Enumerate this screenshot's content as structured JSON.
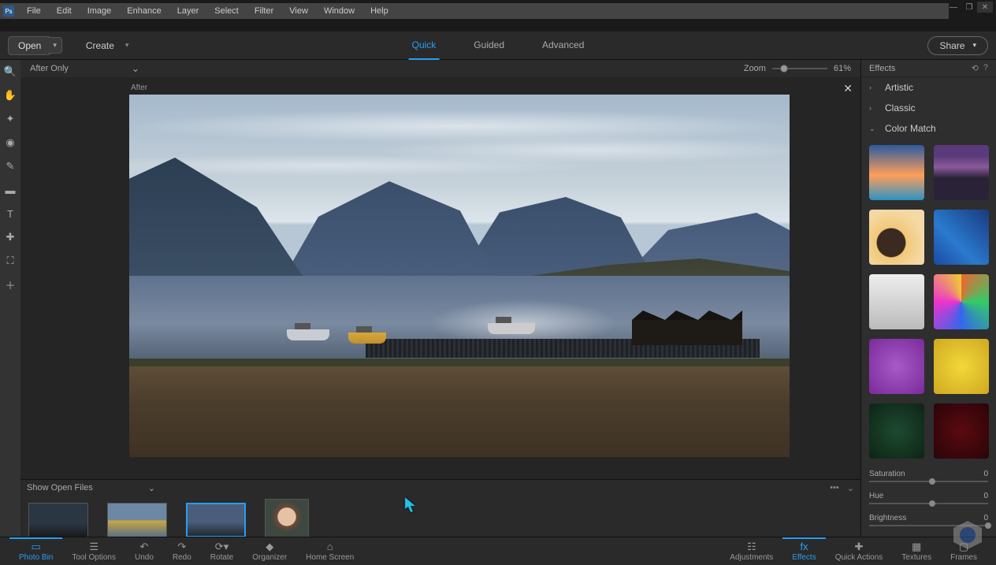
{
  "window": {
    "minimize": "—",
    "maximize": "❐",
    "close": "✕"
  },
  "menu": [
    "File",
    "Edit",
    "Image",
    "Enhance",
    "Layer",
    "Select",
    "Filter",
    "View",
    "Window",
    "Help"
  ],
  "action": {
    "open": "Open",
    "create": "Create",
    "share": "Share"
  },
  "tabs": {
    "quick": "Quick",
    "guided": "Guided",
    "advanced": "Advanced"
  },
  "view_mode": "After Only",
  "zoom": {
    "label": "Zoom",
    "value": "61%"
  },
  "after_label": "After",
  "bin": {
    "label": "Show Open Files"
  },
  "right": {
    "header": "Effects",
    "cats": {
      "artistic": "Artistic",
      "classic": "Classic",
      "colormatch": "Color Match"
    },
    "sliders": {
      "saturation": {
        "label": "Saturation",
        "value": "0"
      },
      "hue": {
        "label": "Hue",
        "value": "0"
      },
      "brightness": {
        "label": "Brightness",
        "value": "0"
      }
    }
  },
  "bottom": {
    "photo_bin": "Photo Bin",
    "tool_options": "Tool Options",
    "undo": "Undo",
    "redo": "Redo",
    "rotate": "Rotate",
    "organizer": "Organizer",
    "home": "Home Screen",
    "adjustments": "Adjustments",
    "effects": "Effects",
    "quick_actions": "Quick Actions",
    "textures": "Textures",
    "frames": "Frames"
  },
  "tool_icons": [
    "zoom",
    "hand",
    "lasso",
    "eye",
    "heal",
    "brush",
    "type",
    "eyedropper",
    "crop",
    "move"
  ]
}
